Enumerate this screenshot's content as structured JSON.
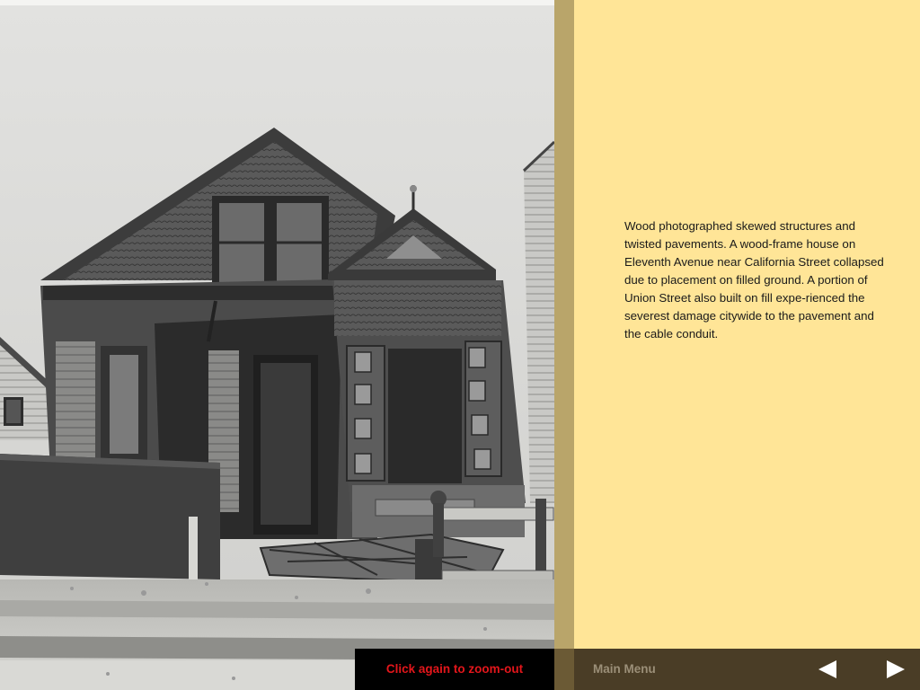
{
  "photo": {
    "subject": "collapsed wood-frame house"
  },
  "caption": {
    "text": "Wood photographed skewed structures and twisted pavements. A wood-frame house on Eleventh Avenue near California Street collapsed due to placement on filled ground. A portion of Union Street also built on fill expe-rienced the severest damage citywide to the pavement and the cable conduit."
  },
  "zoom_notice": {
    "label": "Click again to zoom-out"
  },
  "nav": {
    "main_menu_label": "Main Menu",
    "prev_icon": "triangle-left-icon",
    "next_icon": "triangle-right-icon"
  },
  "colors": {
    "caption_bg": "#ffe597",
    "divider": "#b9a56a",
    "bar_bg": "#4a3d26",
    "zoom_text": "#e3161b",
    "menu_text": "#9b8f78"
  }
}
